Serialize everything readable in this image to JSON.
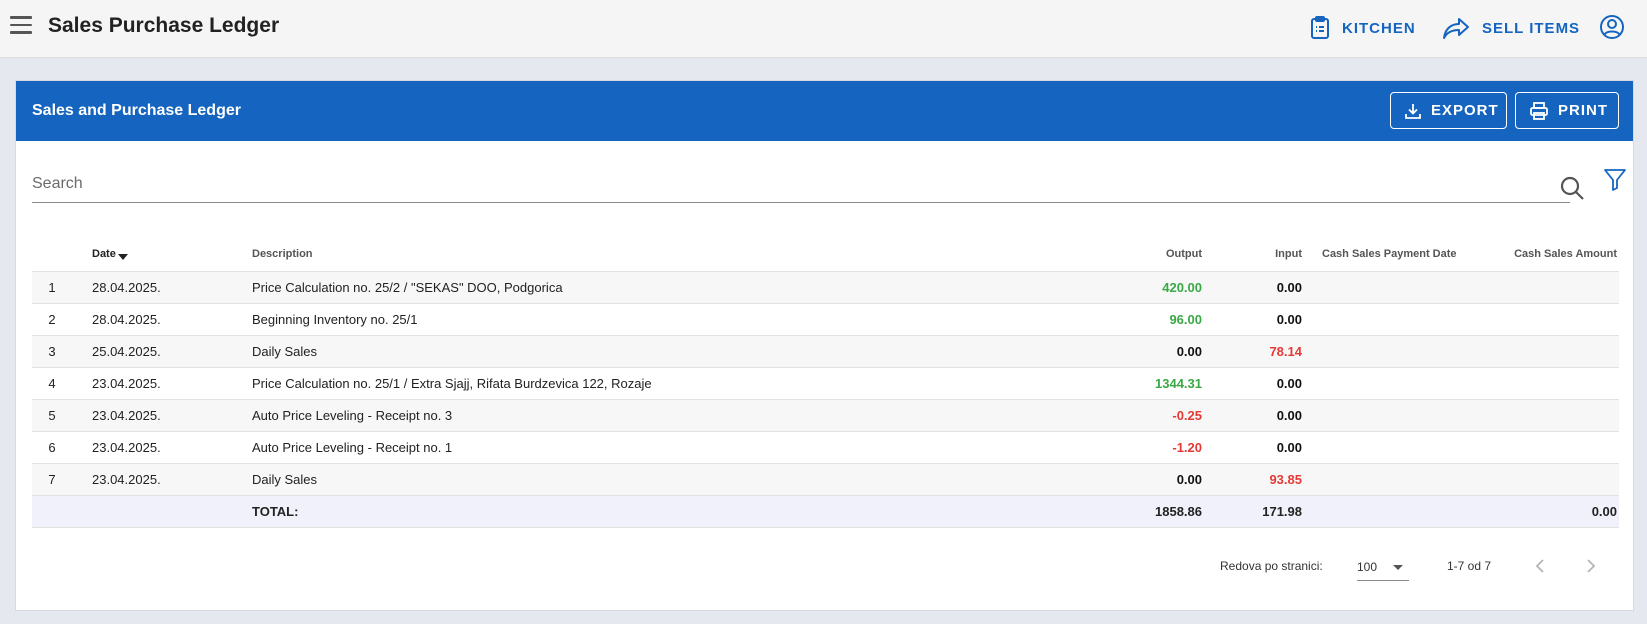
{
  "app": {
    "title": "Sales Purchase Ledger",
    "actions": {
      "kitchen": "KITCHEN",
      "sell_items": "SELL ITEMS"
    }
  },
  "card": {
    "title": "Sales and Purchase Ledger",
    "export_label": "EXPORT",
    "print_label": "PRINT"
  },
  "search": {
    "placeholder": "Search"
  },
  "table": {
    "headers": {
      "date": "Date",
      "description": "Description",
      "output": "Output",
      "input": "Input",
      "cash_sales_payment_date": "Cash Sales Payment Date",
      "cash_sales_amount": "Cash Sales Amount"
    },
    "rows": [
      {
        "idx": "1",
        "date": "28.04.2025.",
        "description": "Price Calculation no. 25/2 / \"SEKAS\" DOO, Podgorica",
        "output": "420.00",
        "input": "0.00",
        "cs_date": "",
        "cs_amount": ""
      },
      {
        "idx": "2",
        "date": "28.04.2025.",
        "description": "Beginning Inventory no. 25/1",
        "output": "96.00",
        "input": "0.00",
        "cs_date": "",
        "cs_amount": ""
      },
      {
        "idx": "3",
        "date": "25.04.2025.",
        "description": "Daily Sales",
        "output": "0.00",
        "input": "78.14",
        "cs_date": "",
        "cs_amount": ""
      },
      {
        "idx": "4",
        "date": "23.04.2025.",
        "description": "Price Calculation no. 25/1 / Extra Sjajj, Rifata Burdzevica 122, Rozaje",
        "output": "1344.31",
        "input": "0.00",
        "cs_date": "",
        "cs_amount": ""
      },
      {
        "idx": "5",
        "date": "23.04.2025.",
        "description": "Auto Price Leveling - Receipt no. 3",
        "output": "-0.25",
        "input": "0.00",
        "cs_date": "",
        "cs_amount": ""
      },
      {
        "idx": "6",
        "date": "23.04.2025.",
        "description": "Auto Price Leveling - Receipt no. 1",
        "output": "-1.20",
        "input": "0.00",
        "cs_date": "",
        "cs_amount": ""
      },
      {
        "idx": "7",
        "date": "23.04.2025.",
        "description": "Daily Sales",
        "output": "0.00",
        "input": "93.85",
        "cs_date": "",
        "cs_amount": ""
      }
    ],
    "total": {
      "label": "TOTAL:",
      "output": "1858.86",
      "input": "171.98",
      "cs_amount": "0.00"
    }
  },
  "pagination": {
    "rows_per_page_label": "Redova po stranici:",
    "rows_per_page": "100",
    "range": "1-7 od 7"
  },
  "colors": {
    "accent": "#1565c0",
    "positive": "#3aa845",
    "negative": "#e53935"
  }
}
